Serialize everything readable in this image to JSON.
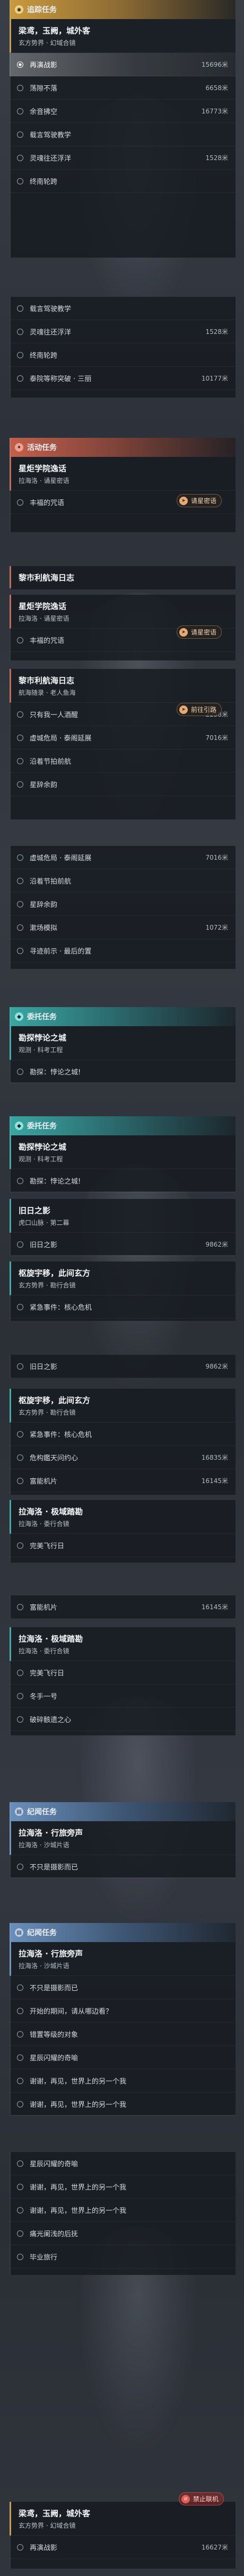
{
  "nav_section": {
    "title": "追踪任务"
  },
  "block1": {
    "title": "梁鸢，玉阙，城外客",
    "sub": "玄方势界 · 幻域合镜",
    "objectives": [
      {
        "label": "再演战影",
        "dist": "15696米"
      },
      {
        "label": "荡隙不落",
        "dist": "6658米"
      },
      {
        "label": "余音拂空",
        "dist": "16773米"
      },
      {
        "label": "载言驾驶教学",
        "dist": ""
      },
      {
        "label": "灵魂往还浮洋",
        "dist": "1528米"
      },
      {
        "label": "终南轮跨",
        "dist": ""
      }
    ]
  },
  "block2": {
    "objectives": [
      {
        "label": "载言驾驶教学",
        "dist": ""
      },
      {
        "label": "灵魂往还浮洋",
        "dist": "1528米"
      },
      {
        "label": "终南轮跨",
        "dist": ""
      },
      {
        "label": "泰院等称突破 · 三丽",
        "dist": "10177米"
      }
    ]
  },
  "act_section": {
    "title": "活动任务"
  },
  "block3": {
    "title": "星炬学院逸话",
    "sub": "拉海洛 · 诵星密语",
    "track": "请星密语",
    "objectives": [
      {
        "label": "丰福的咒语",
        "dist": ""
      }
    ]
  },
  "block4": {
    "title": "黎市利航海日志"
  },
  "block5": {
    "title": "星炬学院逸话",
    "sub": "拉海洛 · 诵星密语",
    "track": "请星密语",
    "objectives": [
      {
        "label": "丰福的咒语",
        "dist": ""
      }
    ]
  },
  "block6": {
    "title": "黎市利航海日志",
    "sub": "航海随录 · 老人鱼海",
    "track": "前往引路",
    "objectives": [
      {
        "label": "只有我一人酒醒",
        "dist": "2258米"
      },
      {
        "label": "虚城危局 · 泰阁延展",
        "dist": "7016米"
      },
      {
        "label": "沿着节拍前航",
        "dist": ""
      },
      {
        "label": "星辞余韵",
        "dist": ""
      }
    ]
  },
  "block7": {
    "objectives": [
      {
        "label": "虚城危局 · 泰阁延展",
        "dist": "7016米"
      },
      {
        "label": "沿着节拍前航",
        "dist": ""
      },
      {
        "label": "星辞余韵",
        "dist": ""
      },
      {
        "label": "漱场模拟",
        "dist": "1072米"
      },
      {
        "label": "寻迹前示 · 最后的置",
        "dist": ""
      }
    ]
  },
  "req_section": {
    "title": "委托任务"
  },
  "block8": {
    "title": "勘探悖论之城",
    "sub": "观测 · 科考工程",
    "objectives": [
      {
        "label": "勘探：悖论之城!",
        "dist": ""
      }
    ]
  },
  "req_section2": {
    "title": "委托任务"
  },
  "block9": {
    "title": "勘探悖论之城",
    "sub": "观测 · 科考工程",
    "objectives": [
      {
        "label": "勘探：悖论之城!",
        "dist": ""
      }
    ]
  },
  "block10": {
    "title": "旧日之影",
    "sub": "虎口山脉 · 第二幕",
    "objectives": [
      {
        "label": "旧日之影",
        "dist": "9862米"
      }
    ]
  },
  "block11": {
    "title": "枢旋宇移，此间玄方",
    "sub": "玄方势界 · 勘行合镜",
    "objectives": [
      {
        "label": "紧急事件：核心危机",
        "dist": ""
      }
    ]
  },
  "block12": {
    "objectives": [
      {
        "label": "旧日之影",
        "dist": "9862米"
      }
    ]
  },
  "block13": {
    "title": "枢旋宇移，此间玄方",
    "sub": "玄方势界 · 勘行合镜",
    "objectives": [
      {
        "label": "紧急事件：核心危机",
        "dist": ""
      },
      {
        "label": "危构鑑天问约心",
        "dist": "16835米"
      },
      {
        "label": "富能机片",
        "dist": "16145米"
      }
    ]
  },
  "block14": {
    "title": "拉海洛 · 极域踏勘",
    "sub": "拉海洛 · 委行合镜",
    "objectives": [
      {
        "label": "完美飞行日",
        "dist": ""
      }
    ]
  },
  "block15": {
    "objectives": [
      {
        "label": "富能机片",
        "dist": "16145米"
      }
    ]
  },
  "block16": {
    "title": "拉海洛 · 极域踏勘",
    "sub": "拉海洛 · 委行合镜",
    "objectives": [
      {
        "label": "完美飞行日",
        "dist": ""
      },
      {
        "label": "冬手一号",
        "dist": ""
      },
      {
        "label": "破碎骸遗之心",
        "dist": ""
      }
    ]
  },
  "lore_section": {
    "title": "纪闻任务"
  },
  "block17": {
    "title": "拉海洛 · 行旅旁声",
    "sub": "拉海洛 · 沙城片语",
    "objectives": [
      {
        "label": "不只是摄影而已",
        "dist": ""
      }
    ]
  },
  "lore_section2": {
    "title": "纪闻任务"
  },
  "block18": {
    "title": "拉海洛 · 行旅旁声",
    "sub": "拉海洛 · 沙城片语",
    "objectives": [
      {
        "label": "不只是摄影而已",
        "dist": ""
      },
      {
        "label": "开始的期间，请从哪边看？",
        "dist": ""
      },
      {
        "label": "错置等级的对象",
        "dist": ""
      },
      {
        "label": "星辰闪耀的奇喻",
        "dist": ""
      },
      {
        "label": "谢谢，再见，世界上的另一个我",
        "dist": ""
      },
      {
        "label": "谢谢，再见，世界上的另一个我",
        "dist": ""
      }
    ]
  },
  "block19": {
    "objectives": [
      {
        "label": "星辰闪耀的奇喻",
        "dist": ""
      },
      {
        "label": "谢谢，再见，世界上的另一个我",
        "dist": ""
      },
      {
        "label": "谢谢，再见，世界上的另一个我",
        "dist": ""
      },
      {
        "label": "痛光阑浅的后抚",
        "dist": ""
      },
      {
        "label": "毕业旅行",
        "dist": ""
      }
    ]
  },
  "block20": {
    "title": "梁鸢，玉阙，城外客",
    "sub": "玄方势界 · 幻域合镜",
    "badge": "禁止联机",
    "objectives": [
      {
        "label": "再演战影",
        "dist": "16627米"
      }
    ]
  }
}
